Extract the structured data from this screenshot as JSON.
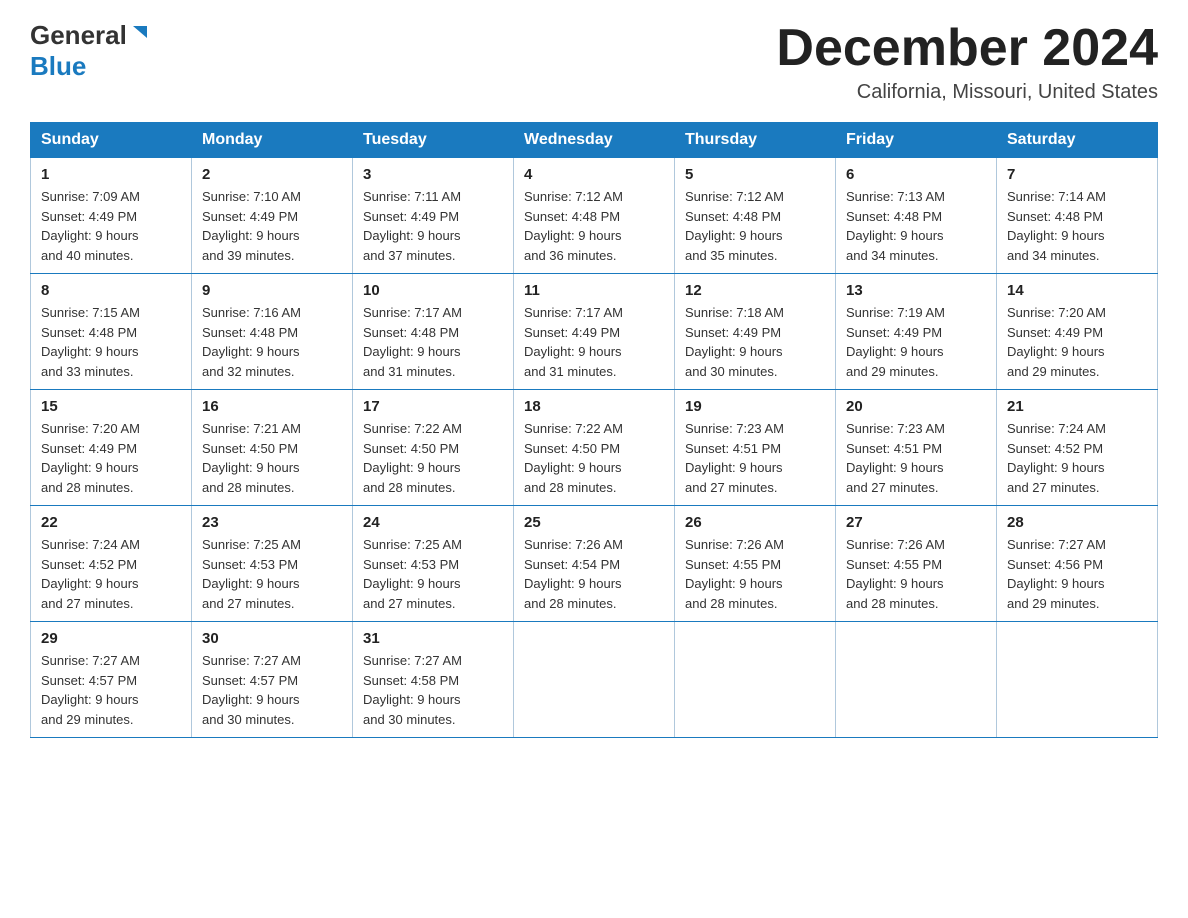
{
  "logo": {
    "general_text": "General",
    "blue_text": "Blue"
  },
  "header": {
    "month_year": "December 2024",
    "location": "California, Missouri, United States"
  },
  "days_of_week": [
    "Sunday",
    "Monday",
    "Tuesday",
    "Wednesday",
    "Thursday",
    "Friday",
    "Saturday"
  ],
  "weeks": [
    [
      {
        "day": "1",
        "sunrise": "7:09 AM",
        "sunset": "4:49 PM",
        "daylight": "9 hours and 40 minutes."
      },
      {
        "day": "2",
        "sunrise": "7:10 AM",
        "sunset": "4:49 PM",
        "daylight": "9 hours and 39 minutes."
      },
      {
        "day": "3",
        "sunrise": "7:11 AM",
        "sunset": "4:49 PM",
        "daylight": "9 hours and 37 minutes."
      },
      {
        "day": "4",
        "sunrise": "7:12 AM",
        "sunset": "4:48 PM",
        "daylight": "9 hours and 36 minutes."
      },
      {
        "day": "5",
        "sunrise": "7:12 AM",
        "sunset": "4:48 PM",
        "daylight": "9 hours and 35 minutes."
      },
      {
        "day": "6",
        "sunrise": "7:13 AM",
        "sunset": "4:48 PM",
        "daylight": "9 hours and 34 minutes."
      },
      {
        "day": "7",
        "sunrise": "7:14 AM",
        "sunset": "4:48 PM",
        "daylight": "9 hours and 34 minutes."
      }
    ],
    [
      {
        "day": "8",
        "sunrise": "7:15 AM",
        "sunset": "4:48 PM",
        "daylight": "9 hours and 33 minutes."
      },
      {
        "day": "9",
        "sunrise": "7:16 AM",
        "sunset": "4:48 PM",
        "daylight": "9 hours and 32 minutes."
      },
      {
        "day": "10",
        "sunrise": "7:17 AM",
        "sunset": "4:48 PM",
        "daylight": "9 hours and 31 minutes."
      },
      {
        "day": "11",
        "sunrise": "7:17 AM",
        "sunset": "4:49 PM",
        "daylight": "9 hours and 31 minutes."
      },
      {
        "day": "12",
        "sunrise": "7:18 AM",
        "sunset": "4:49 PM",
        "daylight": "9 hours and 30 minutes."
      },
      {
        "day": "13",
        "sunrise": "7:19 AM",
        "sunset": "4:49 PM",
        "daylight": "9 hours and 29 minutes."
      },
      {
        "day": "14",
        "sunrise": "7:20 AM",
        "sunset": "4:49 PM",
        "daylight": "9 hours and 29 minutes."
      }
    ],
    [
      {
        "day": "15",
        "sunrise": "7:20 AM",
        "sunset": "4:49 PM",
        "daylight": "9 hours and 28 minutes."
      },
      {
        "day": "16",
        "sunrise": "7:21 AM",
        "sunset": "4:50 PM",
        "daylight": "9 hours and 28 minutes."
      },
      {
        "day": "17",
        "sunrise": "7:22 AM",
        "sunset": "4:50 PM",
        "daylight": "9 hours and 28 minutes."
      },
      {
        "day": "18",
        "sunrise": "7:22 AM",
        "sunset": "4:50 PM",
        "daylight": "9 hours and 28 minutes."
      },
      {
        "day": "19",
        "sunrise": "7:23 AM",
        "sunset": "4:51 PM",
        "daylight": "9 hours and 27 minutes."
      },
      {
        "day": "20",
        "sunrise": "7:23 AM",
        "sunset": "4:51 PM",
        "daylight": "9 hours and 27 minutes."
      },
      {
        "day": "21",
        "sunrise": "7:24 AM",
        "sunset": "4:52 PM",
        "daylight": "9 hours and 27 minutes."
      }
    ],
    [
      {
        "day": "22",
        "sunrise": "7:24 AM",
        "sunset": "4:52 PM",
        "daylight": "9 hours and 27 minutes."
      },
      {
        "day": "23",
        "sunrise": "7:25 AM",
        "sunset": "4:53 PM",
        "daylight": "9 hours and 27 minutes."
      },
      {
        "day": "24",
        "sunrise": "7:25 AM",
        "sunset": "4:53 PM",
        "daylight": "9 hours and 27 minutes."
      },
      {
        "day": "25",
        "sunrise": "7:26 AM",
        "sunset": "4:54 PM",
        "daylight": "9 hours and 28 minutes."
      },
      {
        "day": "26",
        "sunrise": "7:26 AM",
        "sunset": "4:55 PM",
        "daylight": "9 hours and 28 minutes."
      },
      {
        "day": "27",
        "sunrise": "7:26 AM",
        "sunset": "4:55 PM",
        "daylight": "9 hours and 28 minutes."
      },
      {
        "day": "28",
        "sunrise": "7:27 AM",
        "sunset": "4:56 PM",
        "daylight": "9 hours and 29 minutes."
      }
    ],
    [
      {
        "day": "29",
        "sunrise": "7:27 AM",
        "sunset": "4:57 PM",
        "daylight": "9 hours and 29 minutes."
      },
      {
        "day": "30",
        "sunrise": "7:27 AM",
        "sunset": "4:57 PM",
        "daylight": "9 hours and 30 minutes."
      },
      {
        "day": "31",
        "sunrise": "7:27 AM",
        "sunset": "4:58 PM",
        "daylight": "9 hours and 30 minutes."
      },
      null,
      null,
      null,
      null
    ]
  ],
  "labels": {
    "sunrise": "Sunrise:",
    "sunset": "Sunset:",
    "daylight": "Daylight:"
  }
}
